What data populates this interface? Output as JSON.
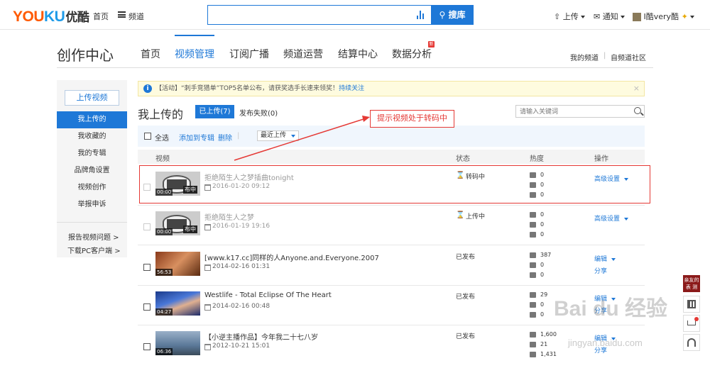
{
  "topbar": {
    "logo_a": "YOU",
    "logo_b": "KU",
    "logo_cn": "优酷",
    "home": "首页",
    "channel": "频道",
    "search_placeholder": "",
    "search_button": "搜库",
    "upload": "上传",
    "notify": "通知",
    "user": "I酷very酷"
  },
  "header": {
    "title": "创作中心",
    "nav": [
      "首页",
      "视频管理",
      "订阅广播",
      "频道运营",
      "结算中心",
      "数据分析"
    ],
    "new_badge": "新",
    "links": [
      "我的频道",
      "自频道社区"
    ]
  },
  "sidebar": {
    "upload_button": "上传视频",
    "items": [
      "我上传的",
      "我收藏的",
      "我的专辑",
      "品牌角设置",
      "视频创作",
      "举报申诉"
    ],
    "footer": [
      "报告视频问题 >",
      "下载PC客户端 >"
    ]
  },
  "notice": {
    "text": "【活动】“刺手竞猎单”TOP5名单公布，请获奖选手长速来领奖！",
    "link": "持续关注"
  },
  "main": {
    "title": "我上传的",
    "tab_uploaded": "已上传(7)",
    "tab_failed": "发布失败(0)",
    "search_placeholder": "请输入关键词"
  },
  "toolbar": {
    "select_all": "全选",
    "add_album": "添加到专辑",
    "delete": "删除",
    "sort": "最近上传"
  },
  "columns": [
    "视频",
    "状态",
    "热度",
    "操作"
  ],
  "rows": [
    {
      "title": "拒绝陌生人之梦插曲tonight",
      "date": "2016-01-20 09:12",
      "status": "转码中",
      "plays": "0",
      "comments": "0",
      "fav": "0",
      "op1": "高级设置",
      "op2": "",
      "duration": "00:00",
      "ribbon": "布中"
    },
    {
      "title": "拒绝陌生人之梦",
      "date": "2016-01-19 19:16",
      "status": "上传中",
      "plays": "0",
      "comments": "0",
      "fav": "0",
      "op1": "高级设置",
      "op2": "",
      "duration": "00:00",
      "ribbon": "布中"
    },
    {
      "title": "[www.k17.cc]同样的人Anyone.and.Everyone.2007",
      "date": "2014-02-16 01:31",
      "status": "已发布",
      "plays": "387",
      "comments": "0",
      "fav": "0",
      "op1": "编辑",
      "op2": "分享",
      "duration": "56:53",
      "ribbon": ""
    },
    {
      "title": "Westlife - Total Eclipse Of The Heart",
      "date": "2014-02-16 00:48",
      "status": "已发布",
      "plays": "29",
      "comments": "0",
      "fav": "0",
      "op1": "编辑",
      "op2": "分享",
      "duration": "04:27",
      "ribbon": ""
    },
    {
      "title": "【小逆主播作品】今年我二十七八岁",
      "date": "2012-10-21 15:01",
      "status": "已发布",
      "plays": "1,600",
      "comments": "21",
      "fav": "1,431",
      "op1": "编辑",
      "op2": "分享",
      "duration": "06:36",
      "ribbon": ""
    }
  ],
  "annotation": {
    "tip": "提示视频处于转码中"
  },
  "right_sidebar": {
    "top_text": "亲友的表 测"
  },
  "watermark": {
    "main": "Bai du 经验",
    "sub": "jingyan.baidu.com"
  },
  "colors": {
    "brand_orange": "#ff5a00",
    "brand_blue": "#1e9be8",
    "accent": "#1e78d7",
    "annotation_red": "#e53935"
  }
}
